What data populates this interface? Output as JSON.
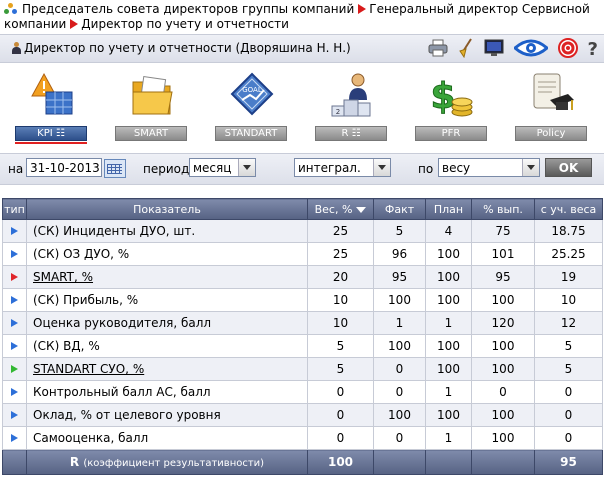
{
  "breadcrumb": {
    "items": [
      "Председатель совета директоров группы компаний",
      "Генеральный директор Сервисной компании",
      "Директор по учету и отчетности"
    ]
  },
  "user": {
    "label": "Директор по учету и отчетности  (Дворяшина Н. Н.)"
  },
  "modules": [
    {
      "label": "KPI ☷",
      "icon": "kpi-warning-icon",
      "active": true
    },
    {
      "label": "SMART",
      "icon": "folder-icon",
      "active": false
    },
    {
      "label": "STANDART",
      "icon": "goal-diamond-icon",
      "active": false
    },
    {
      "label": "R ☷",
      "icon": "podium-icon",
      "active": false
    },
    {
      "label": "PFR",
      "icon": "dollar-coins-icon",
      "active": false
    },
    {
      "label": "Policy",
      "icon": "diploma-icon",
      "active": false
    }
  ],
  "filters": {
    "date_label": "на",
    "date_value": "31-10-2013",
    "period_label": "период",
    "period_value": "месяц",
    "mode_value": "интеграл.",
    "by_label": "по",
    "by_value": "весу",
    "ok_label": "OK"
  },
  "table": {
    "headers": [
      "тип",
      "Показатель",
      "Вес, %",
      "Факт",
      "План",
      "% вып.",
      "с уч. веса"
    ],
    "rows": [
      {
        "type": "blue",
        "name": "(СК) Инциденты ДУО, шт.",
        "link": false,
        "weight": "25",
        "fact": "5",
        "plan": "4",
        "pct": "75",
        "weighted": "18.75"
      },
      {
        "type": "blue",
        "name": "(СК) ОЗ ДУО, %",
        "link": false,
        "weight": "25",
        "fact": "96",
        "plan": "100",
        "pct": "101",
        "weighted": "25.25"
      },
      {
        "type": "red",
        "name": "SMART, %",
        "link": true,
        "weight": "20",
        "fact": "95",
        "plan": "100",
        "pct": "95",
        "weighted": "19"
      },
      {
        "type": "blue",
        "name": "(СК) Прибыль, %",
        "link": false,
        "weight": "10",
        "fact": "100",
        "plan": "100",
        "pct": "100",
        "weighted": "10"
      },
      {
        "type": "blue",
        "name": "Оценка руководителя, балл",
        "link": false,
        "weight": "10",
        "fact": "1",
        "plan": "1",
        "pct": "120",
        "weighted": "12"
      },
      {
        "type": "blue",
        "name": "(СК) ВД, %",
        "link": false,
        "weight": "5",
        "fact": "100",
        "plan": "100",
        "pct": "100",
        "weighted": "5"
      },
      {
        "type": "green",
        "name": "STANDART СУО, %",
        "link": true,
        "weight": "5",
        "fact": "0",
        "plan": "100",
        "pct": "100",
        "weighted": "5"
      },
      {
        "type": "blue",
        "name": "Контрольный балл АС, балл",
        "link": false,
        "weight": "0",
        "fact": "0",
        "plan": "1",
        "pct": "0",
        "weighted": "0"
      },
      {
        "type": "blue",
        "name": "Оклад, % от целевого уровня",
        "link": false,
        "weight": "0",
        "fact": "100",
        "plan": "100",
        "pct": "100",
        "weighted": "0"
      },
      {
        "type": "blue",
        "name": "Самооценка, балл",
        "link": false,
        "weight": "0",
        "fact": "0",
        "plan": "1",
        "pct": "100",
        "weighted": "0"
      }
    ],
    "footer": {
      "r_label": "R",
      "r_note": "(коэффициент результативности)",
      "weight_total": "100",
      "weighted_total": "95"
    }
  },
  "colors": {
    "blue": "#2d6fd8",
    "red": "#e0262b",
    "green": "#33b833"
  }
}
